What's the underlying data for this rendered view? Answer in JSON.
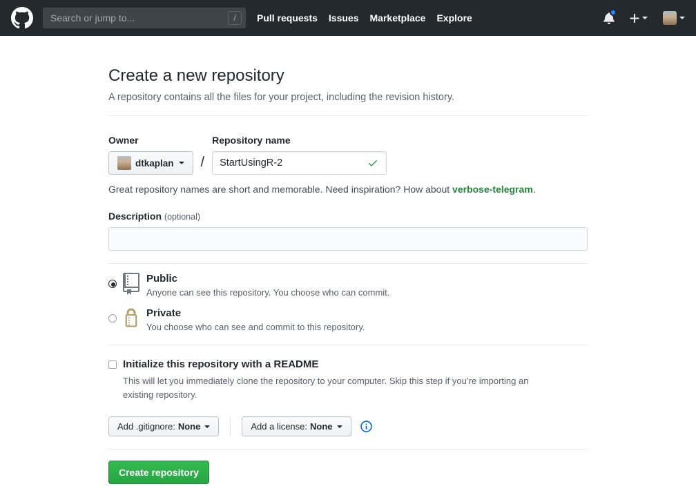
{
  "navbar": {
    "search": {
      "placeholder": "Search or jump to...",
      "shortcut_key": "/"
    },
    "links": [
      {
        "label": "Pull requests"
      },
      {
        "label": "Issues"
      },
      {
        "label": "Marketplace"
      },
      {
        "label": "Explore"
      }
    ],
    "has_unread_notifications": true
  },
  "page": {
    "title": "Create a new repository",
    "subtitle": "A repository contains all the files for your project, including the revision history."
  },
  "form": {
    "owner": {
      "label": "Owner",
      "value": "dtkaplan"
    },
    "separator": "/",
    "repo_name": {
      "label": "Repository name",
      "value": "StartUsingR-2",
      "valid": true
    },
    "hint": {
      "text": "Great repository names are short and memorable. Need inspiration? How about ",
      "suggestion": "verbose-telegram",
      "period": "."
    },
    "description": {
      "label": "Description",
      "optional": "(optional)",
      "value": ""
    },
    "visibility": [
      {
        "label": "Public",
        "description": "Anyone can see this repository. You choose who can commit.",
        "selected": true,
        "icon": "repo-book-icon"
      },
      {
        "label": "Private",
        "description": "You choose who can see and commit to this repository.",
        "selected": false,
        "icon": "lock-icon"
      }
    ],
    "readme": {
      "label": "Initialize this repository with a README",
      "description": "This will let you immediately clone the repository to your computer. Skip this step if you’re importing an existing repository.",
      "checked": false
    },
    "gitignore_button": {
      "prefix": "Add .gitignore:",
      "value": "None"
    },
    "license_button": {
      "prefix": "Add a license:",
      "value": "None"
    },
    "submit_label": "Create repository"
  },
  "colors": {
    "navbar_bg": "#24292e",
    "accent_green": "#28a745",
    "link_green": "#22863a",
    "lock_gold": "#b3a269",
    "repo_icon_gray": "#70787f",
    "notification_blue": "#2188ff",
    "info_blue": "#0366d6",
    "muted_text": "#586069",
    "border": "#d1d5da"
  }
}
